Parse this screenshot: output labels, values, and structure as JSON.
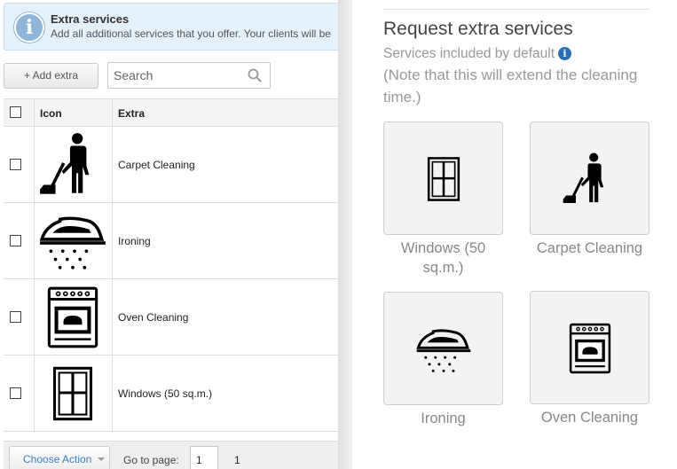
{
  "info_banner": {
    "title": "Extra services",
    "text": "Add all additional services that you offer. Your clients will be"
  },
  "toolbar": {
    "add_label": "+ Add extra",
    "search_placeholder": "Search"
  },
  "grid": {
    "headers": [
      "Icon",
      "Extra"
    ],
    "rows": [
      {
        "icon": "vacuum-person-icon",
        "name": "Carpet Cleaning"
      },
      {
        "icon": "iron-icon",
        "name": "Ironing"
      },
      {
        "icon": "oven-icon",
        "name": "Oven Cleaning"
      },
      {
        "icon": "window-icon",
        "name": "Windows (50 sq.m.)"
      }
    ]
  },
  "footer": {
    "choose_action": "Choose Action",
    "goto_label": "Go to page:",
    "page_value": "1",
    "page_count": "1"
  },
  "panel": {
    "title": "Request extra services",
    "subtitle": "Services included by default",
    "note": "(Note that this will extend the cleaning time.)",
    "cards": [
      {
        "icon": "window-icon",
        "label": "Windows (50 sq.m.)"
      },
      {
        "icon": "vacuum-person-icon",
        "label": "Carpet Cleaning"
      },
      {
        "icon": "iron-icon",
        "label": "Ironing"
      },
      {
        "icon": "oven-icon",
        "label": "Oven Cleaning"
      }
    ]
  },
  "colors": {
    "info_bg": "#e4f0fa",
    "link_blue": "#3a7fc0",
    "info_icon_blue": "#2a6fb5"
  }
}
